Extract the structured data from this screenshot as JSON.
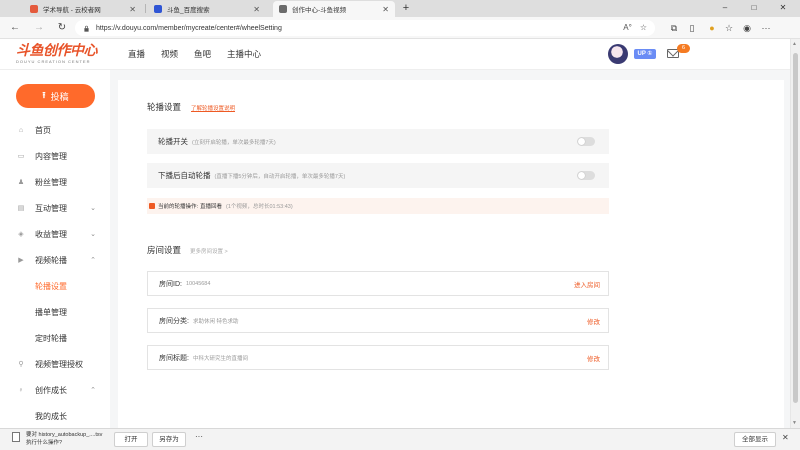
{
  "browser": {
    "tabs": [
      {
        "label": "学术导航 - 云校者网",
        "favicon_color": "#e45a3c"
      },
      {
        "label": "斗鱼_百度搜索",
        "favicon_color": "#2f55d4"
      },
      {
        "label": "创作中心-斗鱼视频",
        "favicon_color": "#6b6b6b"
      }
    ],
    "new_tab": "+",
    "window_controls": [
      "–",
      "□",
      "✕"
    ],
    "url": "https://v.douyu.com/member/mycreate/center#/wheelSetting"
  },
  "site": {
    "logo_text": "斗鱼创作中心",
    "logo_subtext": "DOUYU CREATION CENTER",
    "nav": [
      "直播",
      "视频",
      "鱼吧",
      "主播中心"
    ],
    "up_badge": "UP ①",
    "mail_count": "6",
    "accent": "#ff6a2b"
  },
  "sidebar": {
    "post_button": "投稿",
    "items": [
      {
        "label": "首页",
        "icon": "home-icon",
        "glyph": "⌂",
        "chevron": "",
        "sub": false,
        "active": false
      },
      {
        "label": "内容管理",
        "icon": "content-icon",
        "glyph": "▭",
        "chevron": "",
        "sub": false,
        "active": false
      },
      {
        "label": "粉丝管理",
        "icon": "fans-icon",
        "glyph": "♟",
        "chevron": "",
        "sub": false,
        "active": false
      },
      {
        "label": "互动管理",
        "icon": "interaction-icon",
        "glyph": "▤",
        "chevron": "⌄",
        "sub": false,
        "active": false
      },
      {
        "label": "收益管理",
        "icon": "revenue-icon",
        "glyph": "◈",
        "chevron": "⌄",
        "sub": false,
        "active": false
      },
      {
        "label": "视频轮播",
        "icon": "video-carousel-icon",
        "glyph": "▶",
        "chevron": "⌃",
        "sub": false,
        "active": false
      },
      {
        "label": "轮播设置",
        "icon": "",
        "glyph": "",
        "chevron": "",
        "sub": true,
        "active": true
      },
      {
        "label": "播单管理",
        "icon": "",
        "glyph": "",
        "chevron": "",
        "sub": true,
        "active": false
      },
      {
        "label": "定时轮播",
        "icon": "",
        "glyph": "",
        "chevron": "",
        "sub": true,
        "active": false
      },
      {
        "label": "视频管理授权",
        "icon": "authorization-icon",
        "glyph": "⚲",
        "chevron": "",
        "sub": false,
        "active": false
      },
      {
        "label": "创作成长",
        "icon": "growth-icon",
        "glyph": "♀",
        "chevron": "⌃",
        "sub": false,
        "active": false
      },
      {
        "label": "我的成长",
        "icon": "",
        "glyph": "",
        "chevron": "",
        "sub": true,
        "active": false
      }
    ]
  },
  "main": {
    "carousel": {
      "title": "轮播设置",
      "help_link": "了解轮播设置说明",
      "switch_label": "轮播开关",
      "switch_hint": "(立刻开启轮播，单次最多轮播7天)",
      "auto_label": "下播后自动轮播",
      "auto_hint": "(直播下播5分钟后，自动开启轮播，单次最多轮播7天)",
      "notice_text": "当前的轮播操作:",
      "notice_link": "直播回看",
      "notice_count": "(1个视频，总时长01:53:43)"
    },
    "room": {
      "title": "房间设置",
      "more_link": "更多房间设置 >",
      "rows": [
        {
          "label": "房间ID:",
          "value": "10045684",
          "action": "进入房间"
        },
        {
          "label": "房间分类:",
          "value": "求助休闲 特色求助",
          "action": "修改"
        },
        {
          "label": "房间标题:",
          "value": "中科大研究生的直播间",
          "action": "修改"
        }
      ]
    }
  },
  "download": {
    "line1": "要对 history_autobackup_....tsv",
    "line2": "执行什么操作?",
    "open": "打开",
    "save_as": "另存为",
    "more": "···",
    "show_all": "全部显示",
    "close": "✕"
  }
}
